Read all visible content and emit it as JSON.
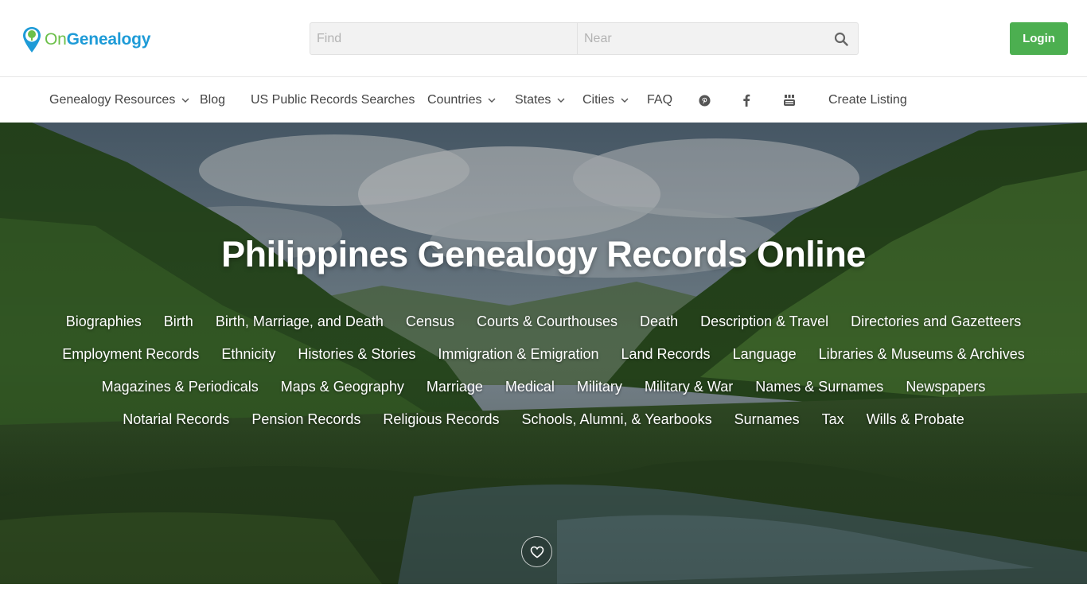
{
  "brand": {
    "name_prefix": "On",
    "name_suffix": "Genealogy",
    "colors": {
      "green": "#6cc04a",
      "blue": "#1e9bd7"
    },
    "icon": "map-pin-tree-icon"
  },
  "search": {
    "find_placeholder": "Find",
    "near_placeholder": "Near",
    "button_icon": "search-icon"
  },
  "login": {
    "label": "Login",
    "color": "#4caf50"
  },
  "nav": {
    "items": [
      {
        "label": "Genealogy Resources",
        "has_dropdown": true
      },
      {
        "label": "Blog",
        "has_dropdown": false
      },
      {
        "label": "US Public Records Searches",
        "has_dropdown": false
      },
      {
        "label": "Countries",
        "has_dropdown": true
      },
      {
        "label": "States",
        "has_dropdown": true
      },
      {
        "label": "Cities",
        "has_dropdown": true
      },
      {
        "label": "FAQ",
        "has_dropdown": false
      }
    ],
    "social_icons": [
      "pinterest-icon",
      "facebook-icon",
      "youtube-icon"
    ],
    "create_listing": "Create Listing"
  },
  "hero": {
    "title": "Philippines Genealogy Records Online",
    "categories": [
      [
        "Biographies",
        "Birth",
        "Birth, Marriage, and Death",
        "Census",
        "Courts & Courthouses",
        "Death",
        "Description & Travel",
        "Directories and Gazetteers"
      ],
      [
        "Employment Records",
        "Ethnicity",
        "Histories & Stories",
        "Immigration & Emigration",
        "Land Records",
        "Language",
        "Libraries & Museums & Archives"
      ],
      [
        "Magazines & Periodicals",
        "Maps & Geography",
        "Marriage",
        "Medical",
        "Military",
        "Military & War",
        "Names & Surnames",
        "Newspapers"
      ],
      [
        "Notarial Records",
        "Pension Records",
        "Religious Records",
        "Schools, Alumni, & Yearbooks",
        "Surnames",
        "Tax",
        "Wills & Probate"
      ]
    ],
    "favorite_icon": "heart-icon"
  }
}
